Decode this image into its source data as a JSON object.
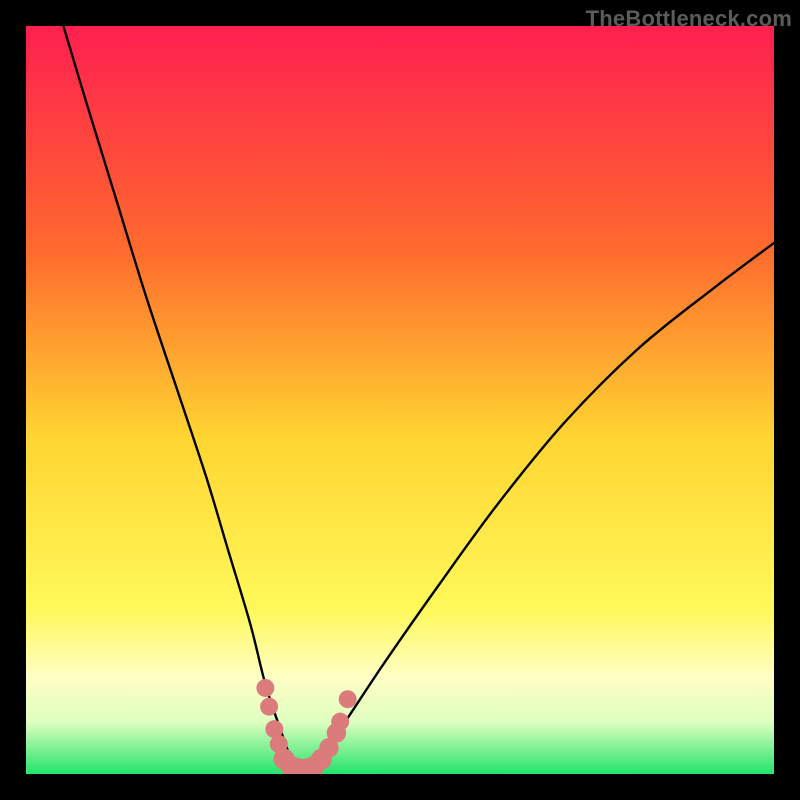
{
  "watermark": "TheBottleneck.com",
  "chart_data": {
    "type": "line",
    "title": "",
    "xlabel": "",
    "ylabel": "",
    "xlim": [
      0,
      100
    ],
    "ylim": [
      0,
      100
    ],
    "grid": false,
    "legend": false,
    "background": {
      "gradient_stops": [
        {
          "pos": 0,
          "color": "#ff1f4f"
        },
        {
          "pos": 0.3,
          "color": "#ff6a2e"
        },
        {
          "pos": 0.55,
          "color": "#ffd531"
        },
        {
          "pos": 0.78,
          "color": "#fff95a"
        },
        {
          "pos": 0.87,
          "color": "#fffec4"
        },
        {
          "pos": 0.93,
          "color": "#dfffc0"
        },
        {
          "pos": 1.0,
          "color": "#23e36b"
        }
      ]
    },
    "series": [
      {
        "name": "bottleneck-curve",
        "color": "#000000",
        "x": [
          5,
          8,
          12,
          16,
          20,
          24,
          27,
          30,
          32,
          34,
          35.5,
          37,
          39,
          42,
          48,
          55,
          63,
          72,
          82,
          92,
          100
        ],
        "y": [
          100,
          90,
          77,
          64,
          52,
          40,
          30,
          20,
          12,
          6,
          2,
          0.5,
          2,
          6,
          15,
          25,
          36,
          47,
          57,
          65,
          71
        ]
      }
    ],
    "markers": {
      "name": "highlight-dots",
      "color": "#db7b7b",
      "points": [
        {
          "x": 32.0,
          "y": 11.5,
          "r": 1.2
        },
        {
          "x": 32.5,
          "y": 9.0,
          "r": 1.2
        },
        {
          "x": 33.2,
          "y": 6.0,
          "r": 1.2
        },
        {
          "x": 33.8,
          "y": 4.0,
          "r": 1.2
        },
        {
          "x": 34.5,
          "y": 2.0,
          "r": 1.4
        },
        {
          "x": 35.5,
          "y": 1.0,
          "r": 1.4
        },
        {
          "x": 36.5,
          "y": 0.7,
          "r": 1.4
        },
        {
          "x": 37.5,
          "y": 0.7,
          "r": 1.4
        },
        {
          "x": 38.5,
          "y": 1.0,
          "r": 1.4
        },
        {
          "x": 39.5,
          "y": 2.0,
          "r": 1.4
        },
        {
          "x": 40.5,
          "y": 3.5,
          "r": 1.3
        },
        {
          "x": 41.5,
          "y": 5.5,
          "r": 1.3
        },
        {
          "x": 42.0,
          "y": 7.0,
          "r": 1.2
        },
        {
          "x": 43.0,
          "y": 10.0,
          "r": 1.2
        }
      ]
    }
  }
}
